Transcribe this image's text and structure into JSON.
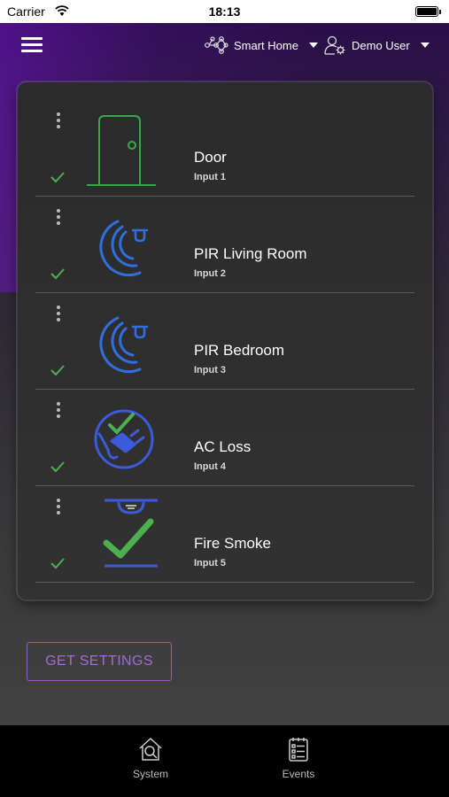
{
  "status_bar": {
    "carrier": "Carrier",
    "time": "18:13"
  },
  "header": {
    "home_label": "Smart Home",
    "user_label": "Demo User",
    "icons": {
      "menu": "hamburger-icon",
      "home": "network-icon",
      "user": "user-settings-icon",
      "dropdown": "caret-down-icon"
    }
  },
  "inputs": [
    {
      "name": "Door",
      "input": "Input 1",
      "icon": "door-icon",
      "status": "check"
    },
    {
      "name": "PIR Living Room",
      "input": "Input 2",
      "icon": "motion-sensor-icon",
      "status": "check"
    },
    {
      "name": "PIR Bedroom",
      "input": "Input 3",
      "icon": "motion-sensor-icon",
      "status": "check"
    },
    {
      "name": "AC Loss",
      "input": "Input 4",
      "icon": "power-plug-icon",
      "status": "check"
    },
    {
      "name": "Fire Smoke",
      "input": "Input 5",
      "icon": "smoke-detector-icon",
      "status": "check"
    }
  ],
  "actions": {
    "get_settings": "GET SETTINGS"
  },
  "tabs": [
    {
      "label": "System",
      "icon": "house-search-icon"
    },
    {
      "label": "Events",
      "icon": "event-list-icon"
    }
  ],
  "colors": {
    "accent": "#9a58c8",
    "check": "#4caf50",
    "sensor_blue": "#2f6fe0",
    "door_green": "#3aa64a"
  }
}
